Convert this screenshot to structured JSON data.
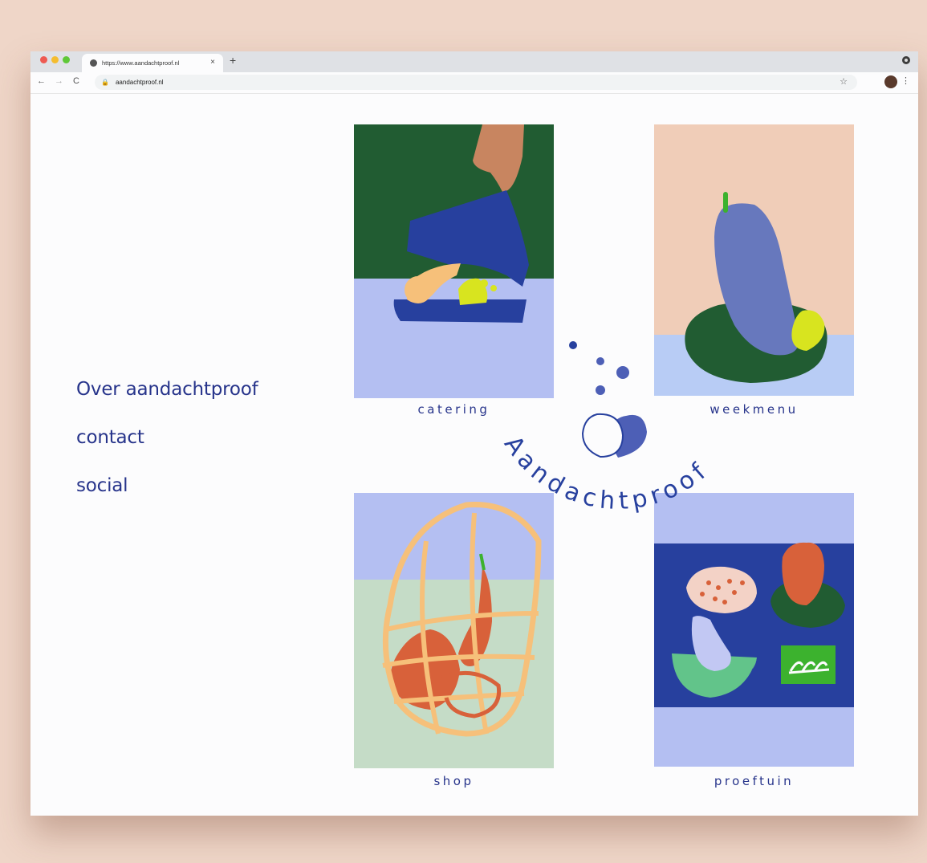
{
  "browser": {
    "tab_title": "https://www.aandachtproof.nl",
    "tab_close": "×",
    "new_tab": "+",
    "url": "aandachtproof.nl",
    "back": "←",
    "forward": "→",
    "reload": "C",
    "bookmark": "☆",
    "menu": "⋮"
  },
  "nav": {
    "items": [
      "Over aandachtproof",
      "contact",
      "social"
    ]
  },
  "cards": [
    {
      "label": "catering"
    },
    {
      "label": "weekmenu"
    },
    {
      "label": "shop"
    },
    {
      "label": "proeftuin"
    }
  ],
  "brand": {
    "wordmark": "Aandachtproof"
  },
  "colors": {
    "brand_blue": "#27348b",
    "page_background": "#efd6c8",
    "content_background": "#fcfcfd"
  }
}
